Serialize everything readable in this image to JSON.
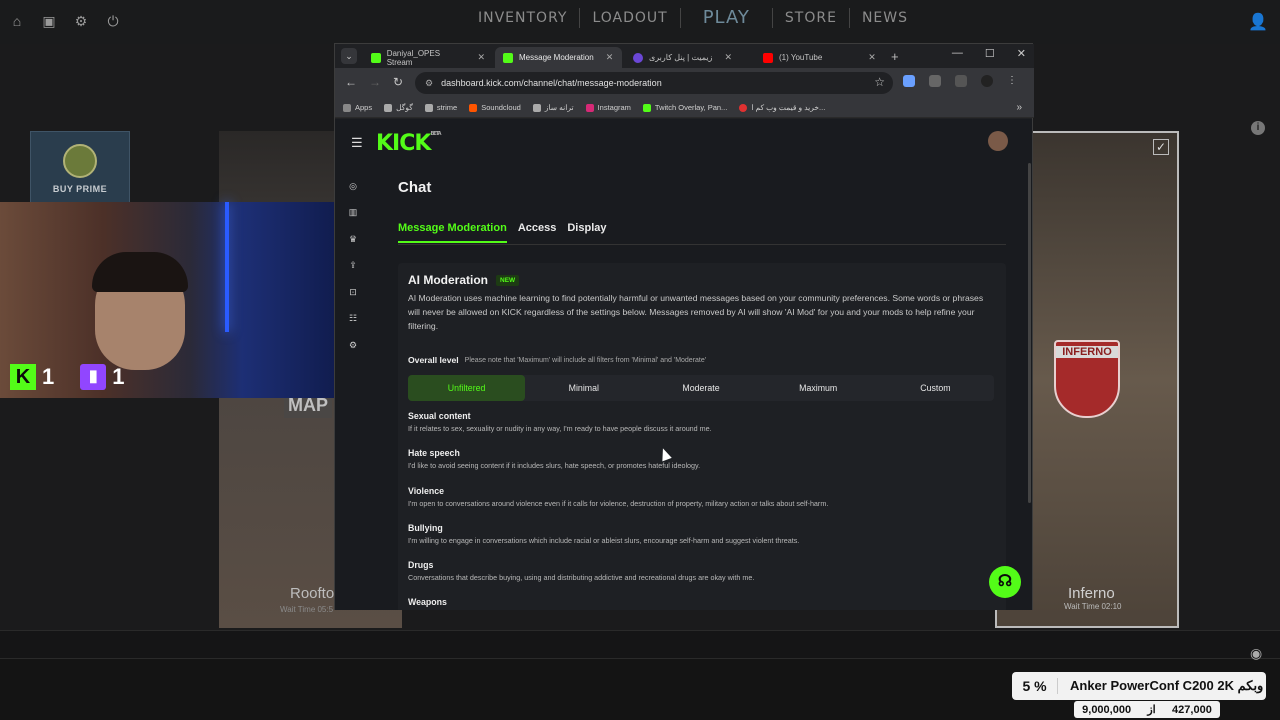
{
  "game": {
    "nav": [
      "INVENTORY",
      "LOADOUT",
      "PLAY",
      "STORE",
      "NEWS"
    ],
    "buy_prime": "BUY PRIME",
    "map_left_label": "MAP",
    "rooftop": {
      "name": "Rooftop",
      "wait": "Wait Time 05:5"
    },
    "inferno": {
      "name": "Inferno",
      "wait": "Wait Time 02:10",
      "badge": "INFERNO"
    }
  },
  "stream_counts": {
    "kick": "1",
    "twitch": "1"
  },
  "browser": {
    "tabs": [
      {
        "label": "Daniyal_OPES Stream",
        "color": "#53fc18",
        "active": false
      },
      {
        "label": "Message Moderation",
        "color": "#53fc18",
        "active": true
      },
      {
        "label": "زیمیت | پنل کاربری",
        "color": "#6b47d6",
        "active": false
      },
      {
        "label": "(1) YouTube",
        "color": "#ff0000",
        "active": false
      }
    ],
    "url": "dashboard.kick.com/channel/chat/message-moderation",
    "bookmarks": [
      {
        "label": "Apps",
        "color": "#888"
      },
      {
        "label": "گوگل",
        "color": "#aaa"
      },
      {
        "label": "strime",
        "color": "#aaa"
      },
      {
        "label": "Soundcloud",
        "color": "#ff5500"
      },
      {
        "label": "ترانه ساز",
        "color": "#aaa"
      },
      {
        "label": "Instagram",
        "color": "#d62976"
      },
      {
        "label": "Twitch Overlay, Pan...",
        "color": "#53fc18"
      },
      {
        "label": "خرید و قیمت وب کم ا...",
        "color": "#e03131"
      }
    ]
  },
  "kick": {
    "logo": "KICK",
    "logo_sup": "BETA",
    "page_title": "Chat",
    "tabs": [
      "Message Moderation",
      "Access",
      "Display"
    ],
    "ai": {
      "title": "AI Moderation",
      "badge": "NEW",
      "description": "AI Moderation uses machine learning to find potentially harmful or unwanted messages based on your community preferences. Some words or phrases will never be allowed on KICK regardless of the settings below. Messages removed by AI will show 'AI Mod' for you and your mods to help refine your filtering."
    },
    "overall": {
      "title": "Overall level",
      "note": "Please note that 'Maximum' will include all filters from 'Minimal' and 'Moderate'"
    },
    "levels": [
      "Unfiltered",
      "Minimal",
      "Moderate",
      "Maximum",
      "Custom"
    ],
    "categories": [
      {
        "title": "Sexual content",
        "desc": "If it relates to sex, sexuality or nudity in any way, I'm ready to have people discuss it around me."
      },
      {
        "title": "Hate speech",
        "desc": "I'd like to avoid seeing content if it includes slurs, hate speech, or promotes hateful ideology."
      },
      {
        "title": "Violence",
        "desc": "I'm open to conversations around violence even if it calls for violence, destruction of property, military action or talks about self-harm."
      },
      {
        "title": "Bullying",
        "desc": "I'm willing to engage in conversations which include racial or ableist slurs, encourage self-harm and suggest violent threats."
      },
      {
        "title": "Drugs",
        "desc": "Conversations that describe buying, using and distributing addictive and recreational drugs are okay with me."
      },
      {
        "title": "Weapons",
        "desc": ""
      }
    ]
  },
  "ad": {
    "percent": "5 %",
    "name": "Anker PowerConf C200 2K وبکم",
    "old_price": "427,000",
    "from": "از",
    "price": "9,000,000"
  }
}
